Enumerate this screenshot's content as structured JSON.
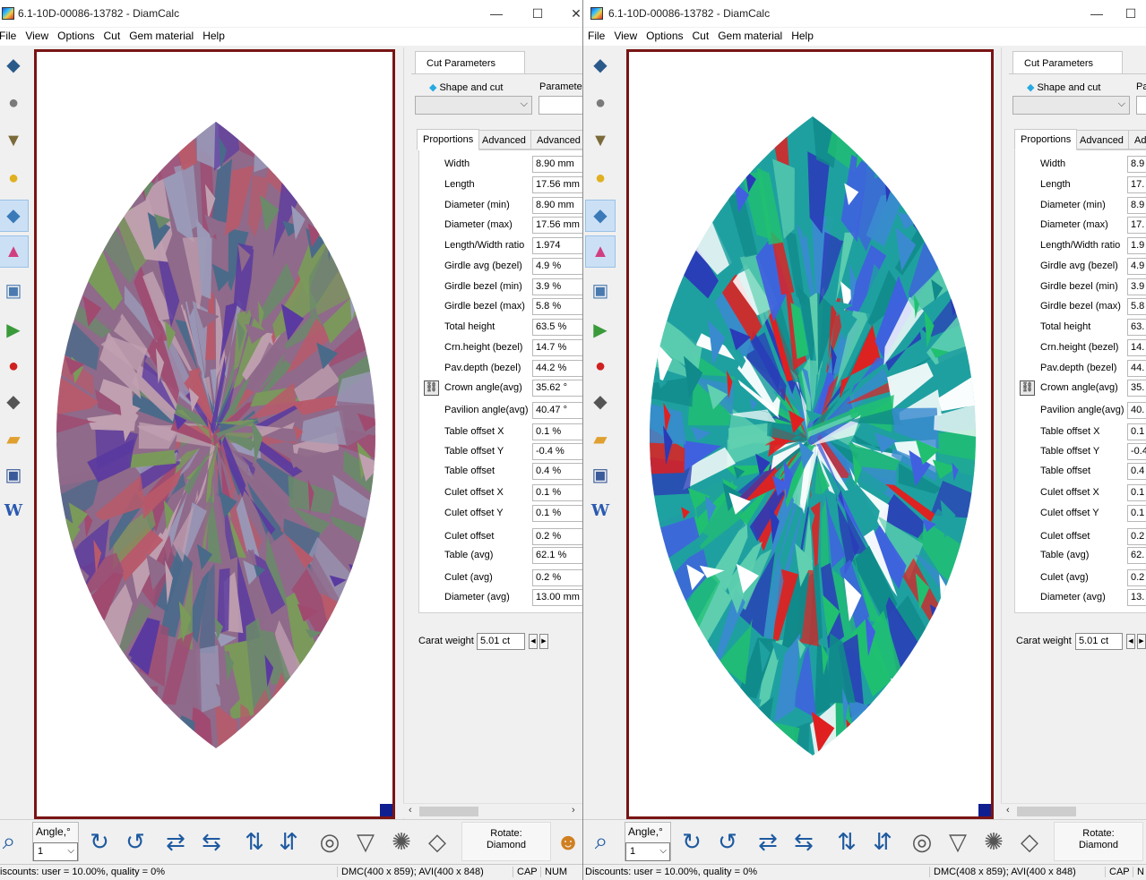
{
  "windows": [
    {
      "title": "6.1-10D-00086-13782 - DiamCalc",
      "menu": [
        "File",
        "View",
        "Options",
        "Cut",
        "Gem material",
        "Help"
      ],
      "panel": {
        "tab_label": "Cut Parameters",
        "shape_label": "Shape and cut",
        "param_label": "Parameter",
        "subtabs": [
          "Proportions",
          "Advanced",
          "Advanced"
        ],
        "properties": [
          {
            "label": "Width",
            "value": "8.90 mm"
          },
          {
            "label": "Length",
            "value": "17.56 mm"
          },
          {
            "label": "Diameter (min)",
            "value": "8.90 mm"
          },
          {
            "label": "Diameter (max)",
            "value": "17.56 mm"
          },
          {
            "label": "Length/Width ratio",
            "value": "1.974"
          },
          {
            "label": "Girdle avg (bezel)",
            "value": "4.9 %"
          },
          {
            "label": "Girdle bezel (min)",
            "value": "3.9 %"
          },
          {
            "label": "Girdle bezel (max)",
            "value": "5.8 %"
          },
          {
            "label": "Total height",
            "value": "63.5 %"
          },
          {
            "label": "Crn.height (bezel)",
            "value": "14.7 %"
          },
          {
            "label": "Pav.depth (bezel)",
            "value": "44.2 %"
          },
          {
            "label": "Crown angle(avg)",
            "value": "35.62 °"
          },
          {
            "label": "Pavilion angle(avg)",
            "value": "40.47 °"
          },
          {
            "label": "Table offset X",
            "value": "0.1 %"
          },
          {
            "label": "Table offset Y",
            "value": "-0.4 %"
          },
          {
            "label": "Table offset",
            "value": "0.4 %"
          },
          {
            "label": "Culet offset X",
            "value": "0.1 %"
          },
          {
            "label": "Culet offset Y",
            "value": "0.1 %"
          },
          {
            "label": "Culet offset",
            "value": "0.2 %"
          },
          {
            "label": "Table (avg)",
            "value": "62.1 %"
          },
          {
            "label": "Culet (avg)",
            "value": "0.2 %"
          },
          {
            "label": "Diameter (avg)",
            "value": "13.00 mm"
          }
        ],
        "carat_label": "Carat weight",
        "carat_value": "5.01 ct"
      },
      "bottom": {
        "angle_label": "Angle,°",
        "angle_value": "1",
        "rotate_label": "Rotate:",
        "rotate_value": "Diamond"
      },
      "status": {
        "discounts": "iscounts: user = 10.00%, quality = 0%",
        "dims": "DMC(400 x 859); AVI(400 x 848)",
        "cap": "CAP",
        "num": "NUM"
      }
    },
    {
      "title": "6.1-10D-00086-13782 - DiamCalc",
      "menu": [
        "File",
        "View",
        "Options",
        "Cut",
        "Gem material",
        "Help"
      ],
      "panel": {
        "tab_label": "Cut Parameters",
        "shape_label": "Shape and cut",
        "param_label": "Pa",
        "subtabs": [
          "Proportions",
          "Advanced",
          "Adv"
        ],
        "properties": [
          {
            "label": "Width",
            "value": "8.9"
          },
          {
            "label": "Length",
            "value": "17."
          },
          {
            "label": "Diameter (min)",
            "value": "8.9"
          },
          {
            "label": "Diameter (max)",
            "value": "17."
          },
          {
            "label": "Length/Width ratio",
            "value": "1.9"
          },
          {
            "label": "Girdle avg (bezel)",
            "value": "4.9"
          },
          {
            "label": "Girdle bezel (min)",
            "value": "3.9"
          },
          {
            "label": "Girdle bezel (max)",
            "value": "5.8"
          },
          {
            "label": "Total height",
            "value": "63."
          },
          {
            "label": "Crn.height (bezel)",
            "value": "14."
          },
          {
            "label": "Pav.depth (bezel)",
            "value": "44."
          },
          {
            "label": "Crown angle(avg)",
            "value": "35."
          },
          {
            "label": "Pavilion angle(avg)",
            "value": "40."
          },
          {
            "label": "Table offset X",
            "value": "0.1"
          },
          {
            "label": "Table offset Y",
            "value": "-0.4"
          },
          {
            "label": "Table offset",
            "value": "0.4"
          },
          {
            "label": "Culet offset X",
            "value": "0.1"
          },
          {
            "label": "Culet offset Y",
            "value": "0.1"
          },
          {
            "label": "Culet offset",
            "value": "0.2"
          },
          {
            "label": "Table (avg)",
            "value": "62."
          },
          {
            "label": "Culet (avg)",
            "value": "0.2"
          },
          {
            "label": "Diameter (avg)",
            "value": "13."
          }
        ],
        "carat_label": "Carat weight",
        "carat_value": "5.01 ct"
      },
      "bottom": {
        "angle_label": "Angle,°",
        "angle_value": "1",
        "rotate_label": "Rotate:",
        "rotate_value": "Diamond"
      },
      "status": {
        "discounts": "Discounts: user = 10.00%, quality = 0%",
        "dims": "DMC(408 x 859); AVI(400 x 848)",
        "cap": "CAP",
        "num": "N"
      }
    }
  ],
  "window_buttons": {
    "minimize": "—",
    "maximize": "☐",
    "close": "✕"
  },
  "colors": {
    "view_border": "#7a1414",
    "left_palette": [
      "#8f6a8a",
      "#6a8a6a",
      "#b85a6a",
      "#5a3aa0",
      "#9a9ab8",
      "#7a9a5a",
      "#c0a0b0",
      "#4a6a8a",
      "#a04a70"
    ],
    "right_palette": [
      "#1fa0a0",
      "#2a3ab8",
      "#e02020",
      "#20c070",
      "#ffffff",
      "#3a8ad0",
      "#108a8a",
      "#4060e0",
      "#60d0b0"
    ]
  },
  "tool_icons": [
    "diamond-top-icon",
    "diamond-sphere-icon",
    "paint-bucket-icon",
    "light-bulb-icon",
    "diamond-render-icon",
    "spectrum-icon",
    "diamond-picture-icon",
    "video-play-icon",
    "video-record-icon",
    "diamond-film-icon",
    "open-folder-icon",
    "save-disk-icon",
    "word-doc-icon"
  ],
  "bottom_icons": [
    "zoom-icon",
    "rotate-cw-icon",
    "rotate-ccw-icon",
    "flip-horizontal-icon",
    "flip-horizontal-alt-icon",
    "flip-vertical-icon",
    "flip-vertical-alt-icon",
    "top-view-icon",
    "side-view-icon",
    "bottom-view-icon",
    "perspective-view-icon"
  ]
}
